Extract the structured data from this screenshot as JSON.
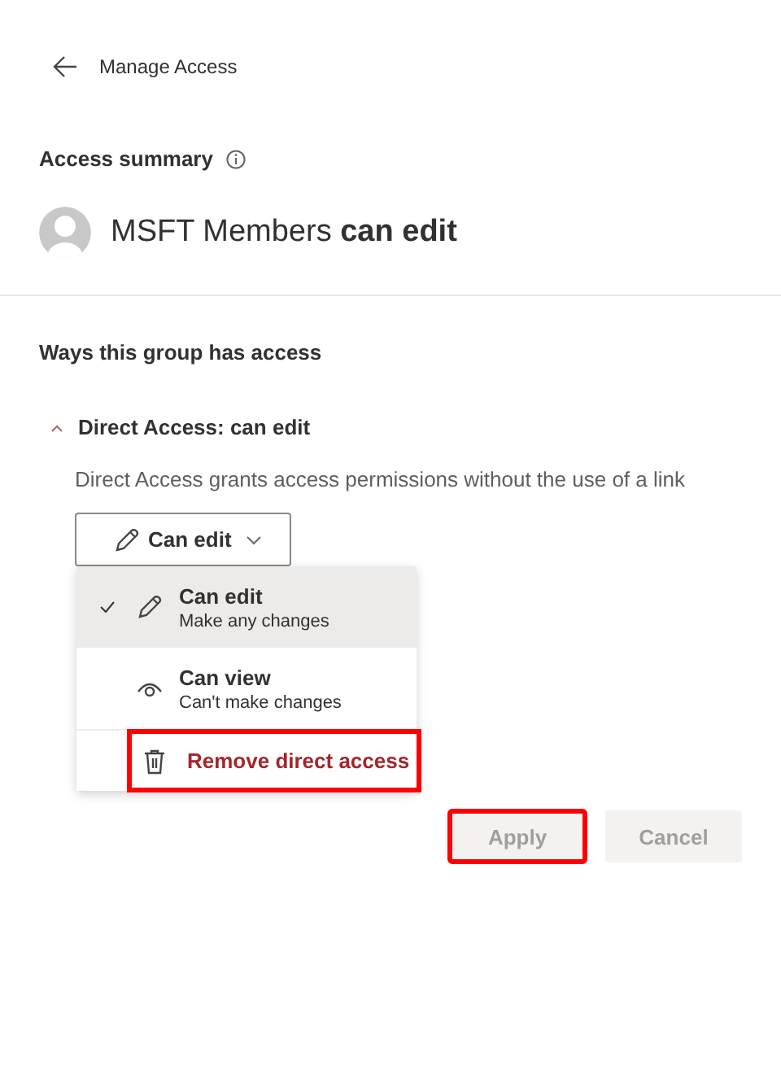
{
  "header": {
    "title": "Manage Access"
  },
  "summary": {
    "title": "Access summary",
    "name": "MSFT Members **can edit**"
  },
  "section": {
    "title": "Ways this group has access"
  },
  "group": {
    "title": "Direct Access: can edit",
    "expanded": true,
    "description": "Direct Access grants access permissions without the use of a link"
  },
  "dropdown": {
    "label": "Can edit",
    "expanded": true
  },
  "menu": [
    {
      "kind": "option",
      "title": "Can edit",
      "subtitle": "Make any changes",
      "selected": true
    },
    {
      "kind": "option",
      "title": "Can view",
      "subtitle": "Can't make changes",
      "selected": false
    },
    {
      "kind": "danger",
      "title": "Remove direct access",
      "highlighted": true
    }
  ],
  "buttons": [
    {
      "label": "Apply",
      "disabled": true,
      "highlighted": true
    },
    {
      "label": "Cancel",
      "disabled": true,
      "highlighted": false
    }
  ]
}
